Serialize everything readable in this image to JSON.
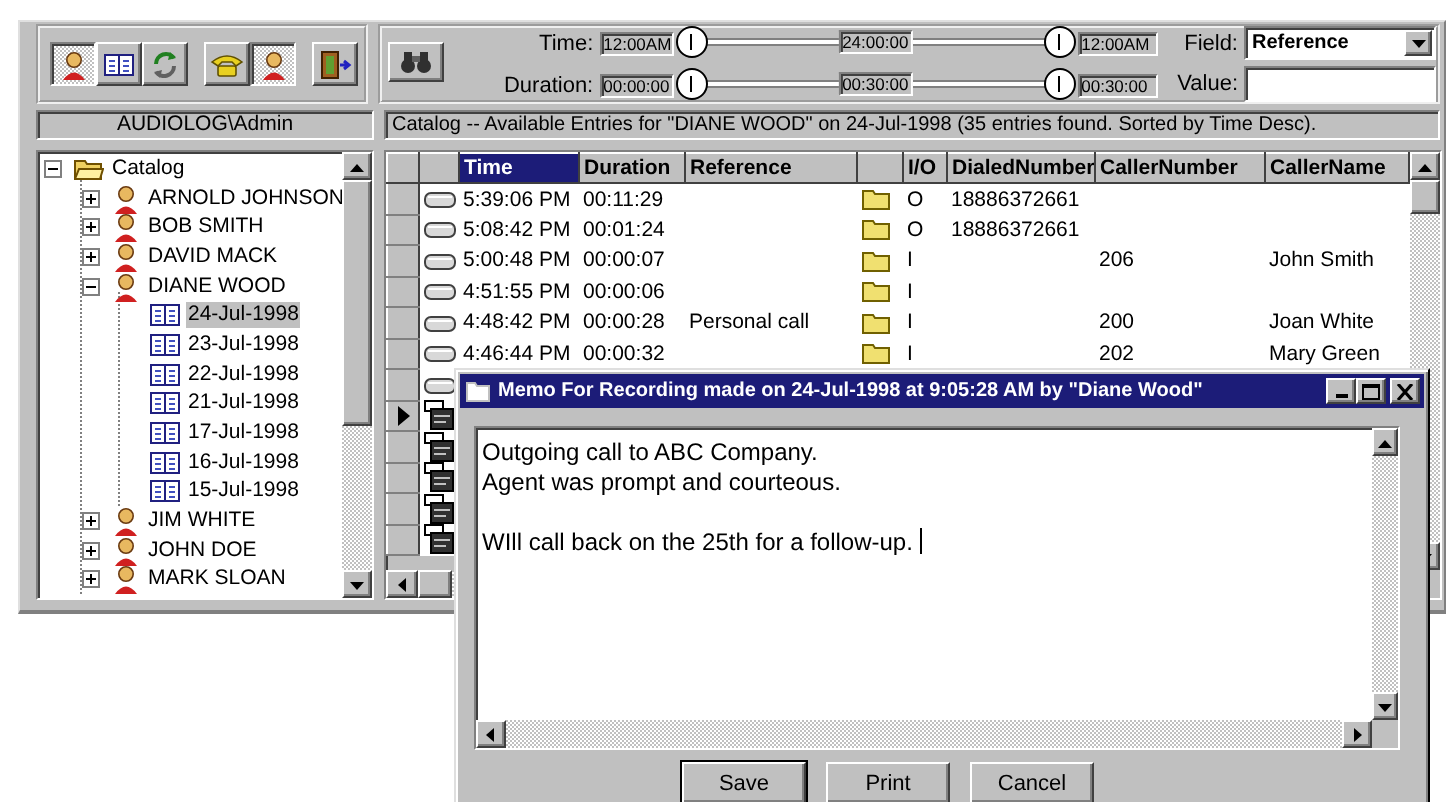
{
  "toolbar": {
    "tool_groups": [
      [
        {
          "kind": "person",
          "pressed": true
        },
        {
          "kind": "book",
          "pressed": false
        },
        {
          "kind": "refresh",
          "pressed": false
        }
      ],
      [
        {
          "kind": "phone",
          "pressed": false
        },
        {
          "kind": "person",
          "pressed": true
        }
      ],
      [
        {
          "kind": "exit",
          "pressed": false
        }
      ]
    ]
  },
  "filter": {
    "sliders": [
      {
        "label": "Time:",
        "from": "12:00AM",
        "middle": "24:00:00",
        "to": "12:00AM"
      },
      {
        "label": "Duration:",
        "from": "00:00:00",
        "middle": "00:30:00",
        "to": "00:30:00"
      }
    ],
    "field": {
      "label": "Field:",
      "value": "Reference"
    },
    "value": {
      "label": "Value:"
    }
  },
  "user_label": "AUDIOLOG\\Admin",
  "catalog_status": "Catalog -- Available Entries for \"DIANE WOOD\" on 24-Jul-1998 (35 entries found. Sorted by Time Desc).",
  "tree": {
    "label": "Catalog",
    "kind": "catalog",
    "expanded": true,
    "selected": false,
    "children": [
      {
        "label": "ARNOLD JOHNSON",
        "kind": "person",
        "expanded": false,
        "selected": false
      },
      {
        "label": "BOB SMITH",
        "kind": "person",
        "expanded": false,
        "selected": false
      },
      {
        "label": "DAVID MACK",
        "kind": "person",
        "expanded": false,
        "selected": false
      },
      {
        "label": "DIANE WOOD",
        "kind": "person",
        "expanded": true,
        "selected": false,
        "children": [
          {
            "label": "24-Jul-1998",
            "kind": "date",
            "selected": true
          },
          {
            "label": "23-Jul-1998",
            "kind": "date",
            "selected": false
          },
          {
            "label": "22-Jul-1998",
            "kind": "date",
            "selected": false
          },
          {
            "label": "21-Jul-1998",
            "kind": "date",
            "selected": false
          },
          {
            "label": "17-Jul-1998",
            "kind": "date",
            "selected": false
          },
          {
            "label": "16-Jul-1998",
            "kind": "date",
            "selected": false
          },
          {
            "label": "15-Jul-1998",
            "kind": "date",
            "selected": false
          }
        ]
      },
      {
        "label": "JIM WHITE",
        "kind": "person",
        "expanded": false,
        "selected": false
      },
      {
        "label": "JOHN DOE",
        "kind": "person",
        "expanded": false,
        "selected": false
      },
      {
        "label": "MARK SLOAN",
        "kind": "person",
        "expanded": false,
        "selected": false
      }
    ]
  },
  "table": {
    "columns": [
      {
        "label": "Time",
        "selected": true
      },
      {
        "label": "Duration",
        "selected": false
      },
      {
        "label": "Reference",
        "selected": false
      },
      {
        "label": "I/O",
        "selected": false
      },
      {
        "label": "DialedNumber",
        "selected": false
      },
      {
        "label": "CallerNumber",
        "selected": false
      },
      {
        "label": "CallerName",
        "selected": false
      }
    ],
    "rows": [
      {
        "kind": "recording",
        "current": false,
        "folder": true,
        "time": "5:39:06 PM",
        "duration": "00:11:29",
        "io": "O",
        "dialed_number": "18886372661"
      },
      {
        "kind": "recording",
        "current": false,
        "folder": true,
        "time": "5:08:42 PM",
        "duration": "00:01:24",
        "io": "O",
        "dialed_number": "18886372661"
      },
      {
        "kind": "recording",
        "current": false,
        "folder": true,
        "time": "5:00:48 PM",
        "duration": "00:00:07",
        "io": "I",
        "caller_number": "206",
        "caller_name": "John Smith"
      },
      {
        "kind": "recording",
        "current": false,
        "folder": true,
        "time": "4:51:55 PM",
        "duration": "00:00:06",
        "io": "I"
      },
      {
        "kind": "recording",
        "current": false,
        "folder": true,
        "time": "4:48:42 PM",
        "duration": "00:00:28",
        "reference": "Personal call",
        "io": "I",
        "caller_number": "200",
        "caller_name": "Joan White"
      },
      {
        "kind": "recording",
        "current": false,
        "folder": true,
        "time": "4:46:44 PM",
        "duration": "00:00:32",
        "io": "I",
        "caller_number": "202",
        "caller_name": "Mary Green"
      },
      {
        "kind": "recording",
        "current": false
      },
      {
        "kind": "memo",
        "current": true
      },
      {
        "kind": "memo",
        "current": false
      },
      {
        "kind": "memo",
        "current": false
      },
      {
        "kind": "memo",
        "current": false
      },
      {
        "kind": "memo",
        "current": false
      }
    ]
  },
  "memo": {
    "title": "Memo For Recording made on 24-Jul-1998 at 9:05:28 AM by \"Diane Wood\"",
    "text": "Outgoing call to ABC Company.\nAgent was prompt and courteous.\n\nWIll call back on the 25th for a follow-up. ",
    "buttons": [
      {
        "label": "Save",
        "default": true
      },
      {
        "label": "Print",
        "default": false
      },
      {
        "label": "Cancel",
        "default": false
      }
    ]
  }
}
